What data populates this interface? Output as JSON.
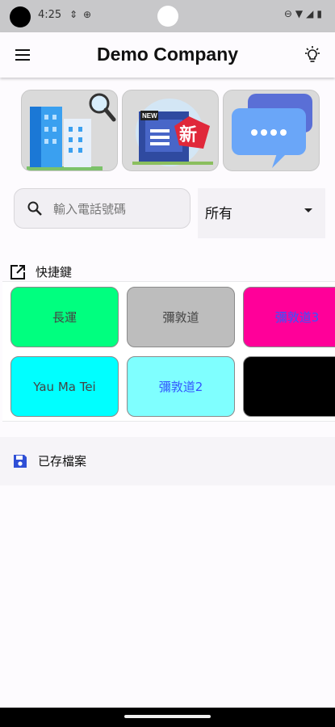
{
  "status_bar": {
    "time": "4:25"
  },
  "app_bar": {
    "title": "Demo Company"
  },
  "tiles": [
    {
      "name": "buildings-search"
    },
    {
      "name": "news"
    },
    {
      "name": "chat"
    }
  ],
  "search": {
    "placeholder": "輸入電話號碼",
    "value": ""
  },
  "filter": {
    "selected": "所有"
  },
  "shortcuts": {
    "title": "快捷鍵",
    "buttons": [
      {
        "label": "長運",
        "bg": "#00ff7f",
        "text": "#444444"
      },
      {
        "label": "彌敦道",
        "bg": "#bdbdbd",
        "text": "#444444"
      },
      {
        "label": "彌敦道3",
        "bg": "#ff0099",
        "text": "#3355ff"
      },
      {
        "label": "Yau Ma Tei",
        "bg": "#00ffff",
        "text": "#444444"
      },
      {
        "label": "彌敦道2",
        "bg": "#7fffff",
        "text": "#3355ff"
      },
      {
        "label": "",
        "bg": "#000000",
        "text": "#ffffff"
      }
    ]
  },
  "saved": {
    "title": "已存檔案"
  }
}
